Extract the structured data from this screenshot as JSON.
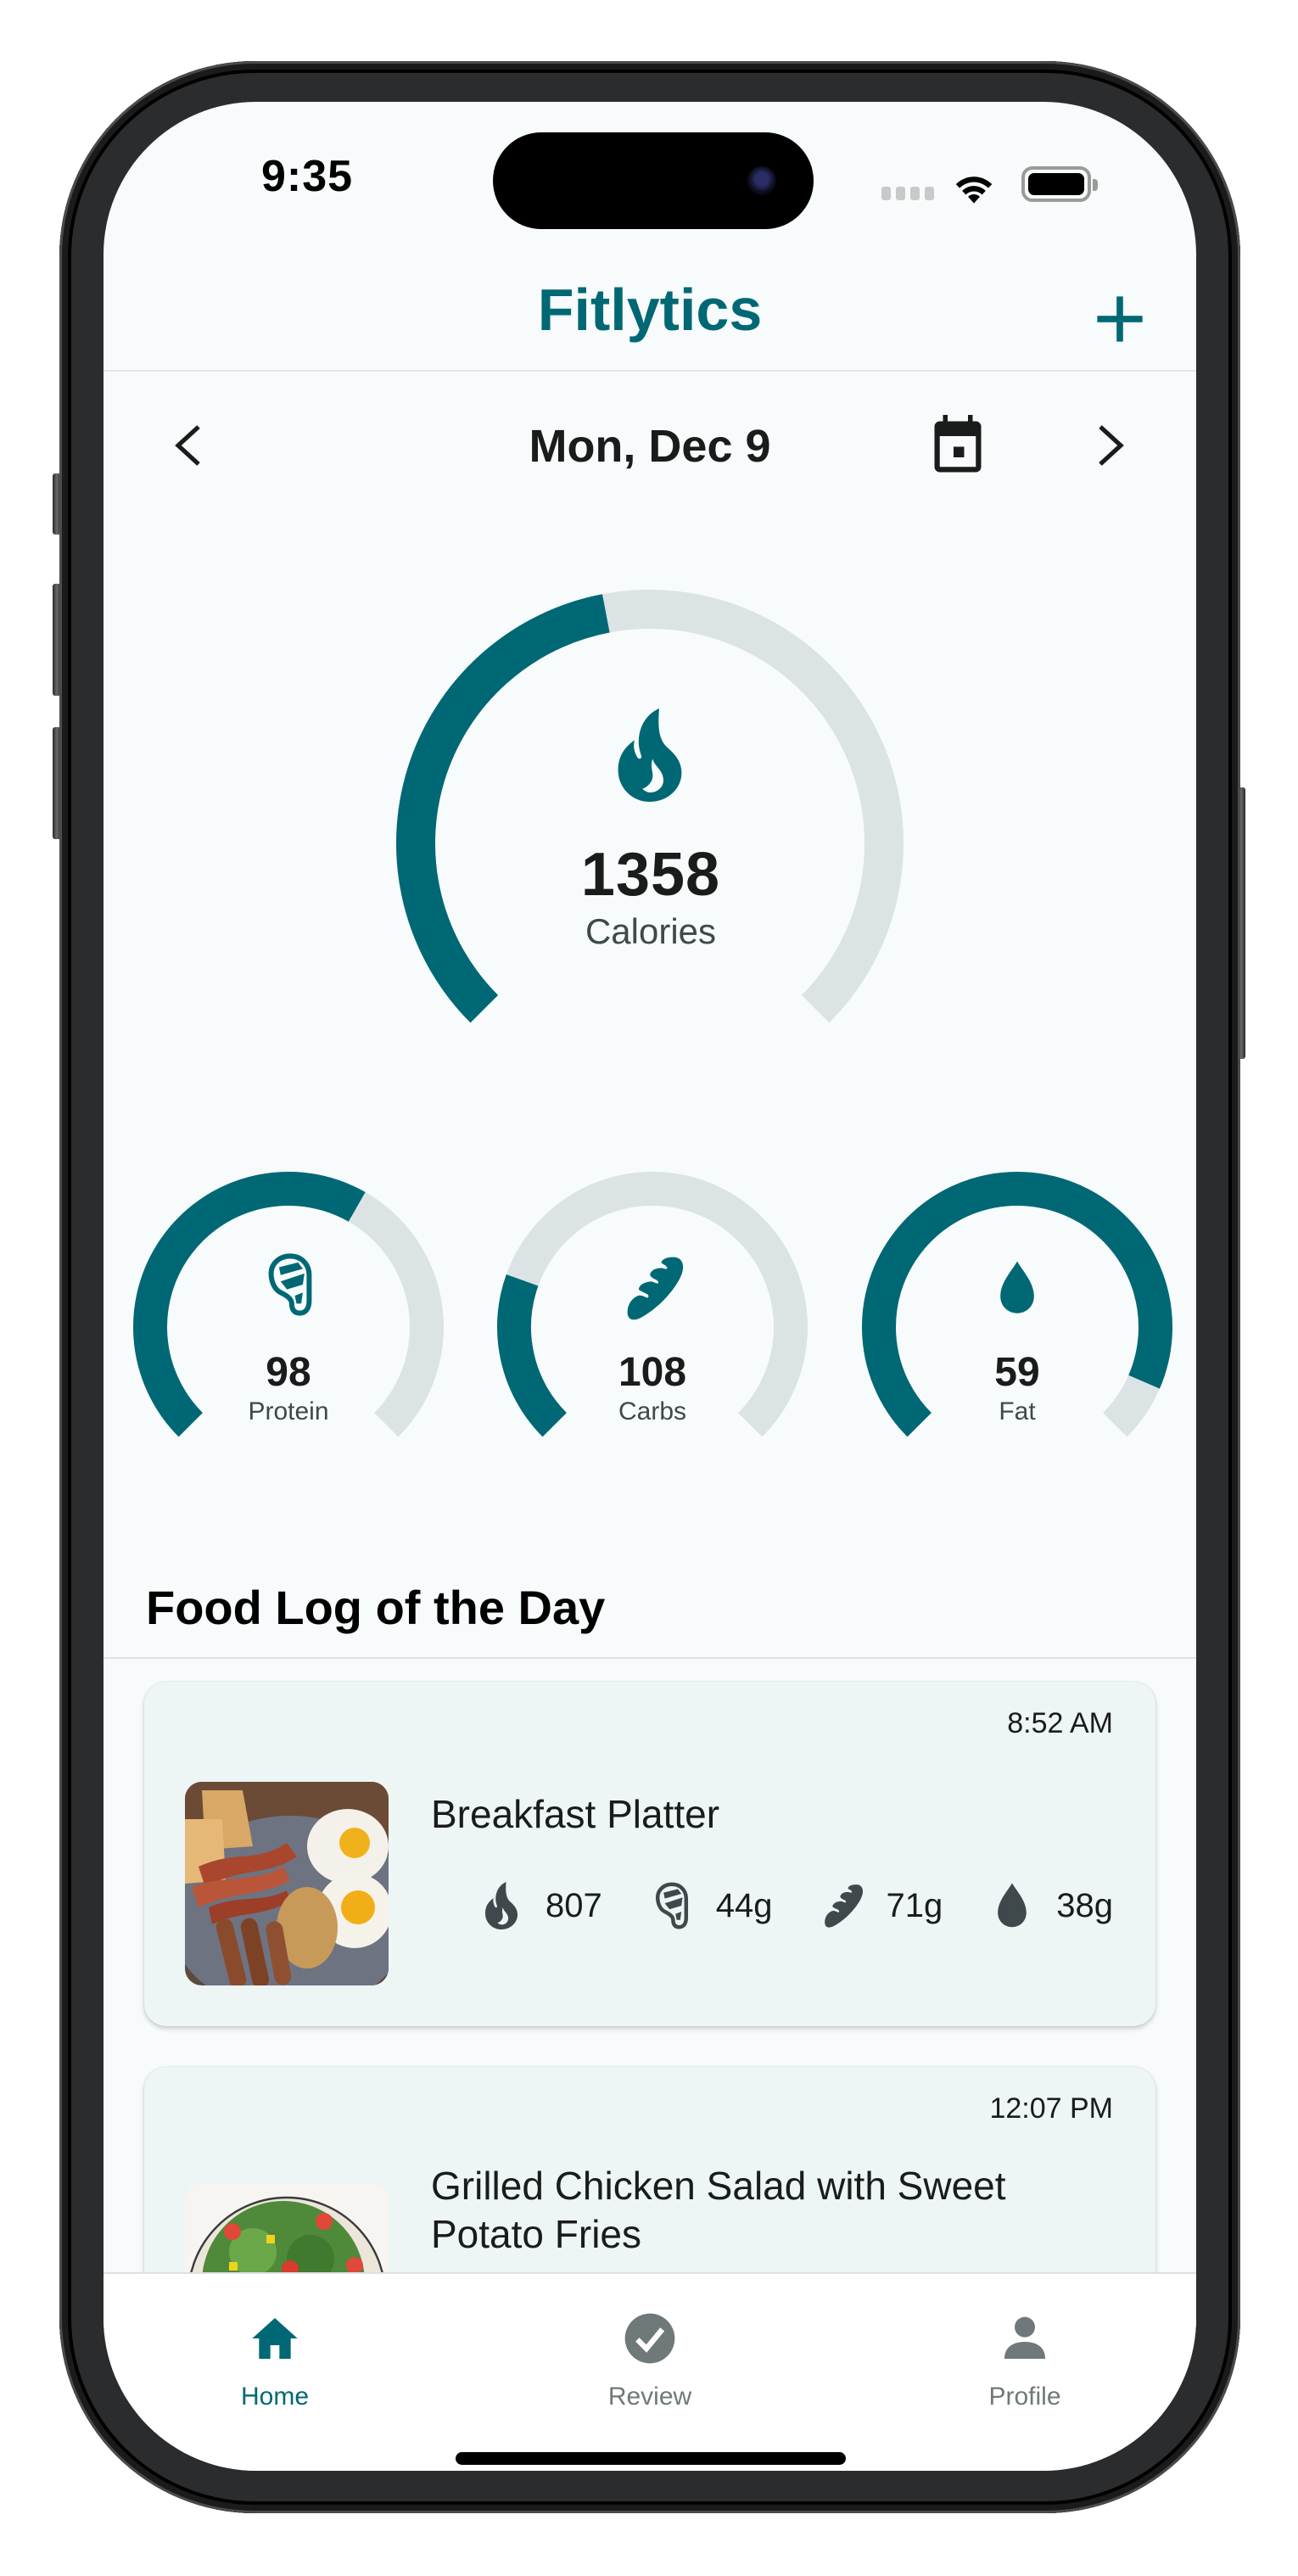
{
  "status_bar": {
    "time": "9:35",
    "battery_level": 1.0
  },
  "header": {
    "title": "Fitlytics",
    "add_icon": "plus-icon"
  },
  "date_nav": {
    "prev_icon": "chevron-left-icon",
    "date": "Mon, Dec 9",
    "calendar_icon": "calendar-icon",
    "next_icon": "chevron-right-icon"
  },
  "colors": {
    "accent": "#006874",
    "track": "#dce3e5",
    "text": "#1a1c1c",
    "muted": "#3f484a",
    "icon_muted": "#6f7979",
    "card_bg": "#eef5f5",
    "screen_bg": "#f7fbfc"
  },
  "calories": {
    "value": "1358",
    "label": "Calories",
    "icon": "flame-icon",
    "progress": 0.46
  },
  "macros": [
    {
      "key": "protein",
      "value": "98",
      "label": "Protein",
      "icon": "meat-icon",
      "progress": 0.61
    },
    {
      "key": "carbs",
      "value": "108",
      "label": "Carbs",
      "icon": "bread-icon",
      "progress": 0.24
    },
    {
      "key": "fat",
      "value": "59",
      "label": "Fat",
      "icon": "drop-icon",
      "progress": 0.92
    }
  ],
  "food_log": {
    "title": "Food Log of the Day",
    "entries": [
      {
        "time": "8:52 AM",
        "name": "Breakfast Platter",
        "calories": "807",
        "protein": "44g",
        "carbs": "71g",
        "fat": "38g",
        "image": "breakfast-platter-photo"
      },
      {
        "time": "12:07 PM",
        "name": "Grilled Chicken Salad with Sweet Potato Fries",
        "image": "chicken-salad-photo"
      }
    ]
  },
  "bottom_nav": {
    "items": [
      {
        "label": "Home",
        "icon": "home-icon",
        "active": true
      },
      {
        "label": "Review",
        "icon": "check-circle-icon",
        "active": false
      },
      {
        "label": "Profile",
        "icon": "person-icon",
        "active": false
      }
    ]
  }
}
